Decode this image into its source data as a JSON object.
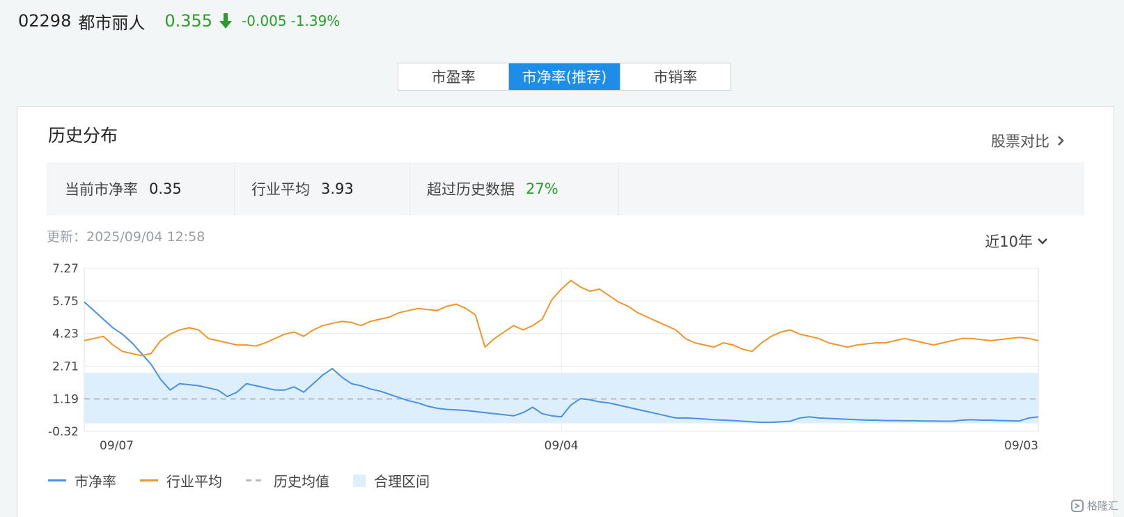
{
  "header": {
    "code": "02298",
    "name": "都市丽人",
    "price": "0.355",
    "change": "-0.005",
    "change_pct": "-1.39%",
    "direction": "down"
  },
  "tabs": [
    {
      "label": "市盈率",
      "active": false
    },
    {
      "label": "市净率(推荐)",
      "active": true
    },
    {
      "label": "市销率",
      "active": false
    }
  ],
  "card": {
    "title": "历史分布",
    "compare_link": "股票对比",
    "stats": [
      {
        "label": "当前市净率",
        "value": "0.35"
      },
      {
        "label": "行业平均",
        "value": "3.93"
      },
      {
        "label": "超过历史数据",
        "value": "27%"
      }
    ],
    "update_label": "更新：",
    "update_time": "2025/09/04 12:58",
    "range_label": "近10年"
  },
  "chart_data": {
    "type": "line",
    "y_ticks": [
      "7.27",
      "5.75",
      "4.23",
      "2.71",
      "1.19",
      "-0.32"
    ],
    "ylim": [
      -0.32,
      7.27
    ],
    "x_ticks": [
      "09/07",
      "09/04",
      "09/03"
    ],
    "historical_mean": 1.19,
    "reasonable_range": [
      0.05,
      2.4
    ],
    "series": [
      {
        "name": "市净率",
        "color": "#4a90e2",
        "x": [
          0,
          1,
          2,
          3,
          4,
          5,
          6,
          7,
          8,
          9,
          10,
          11,
          12,
          13,
          14,
          15,
          16,
          17,
          18,
          19,
          20,
          21,
          22,
          23,
          24,
          25,
          26,
          27,
          28,
          29,
          30,
          31,
          32,
          33,
          34,
          35,
          36,
          37,
          38,
          39,
          40,
          41,
          42,
          43,
          44,
          45,
          46,
          47,
          48,
          49,
          50,
          51,
          52,
          53,
          54,
          55,
          56,
          57,
          58,
          59,
          60,
          61,
          62,
          63,
          64,
          65,
          66,
          67,
          68,
          69,
          70,
          71,
          72,
          73,
          74,
          75,
          76,
          77,
          78,
          79,
          80,
          81,
          82,
          83,
          84,
          85,
          86,
          87,
          88,
          89,
          90,
          91,
          92,
          93,
          94,
          95,
          96,
          97,
          98,
          99,
          100
        ],
        "values": [
          5.7,
          5.3,
          4.9,
          4.5,
          4.2,
          3.8,
          3.3,
          2.8,
          2.1,
          1.6,
          1.9,
          1.85,
          1.8,
          1.7,
          1.6,
          1.3,
          1.5,
          1.9,
          1.8,
          1.7,
          1.6,
          1.6,
          1.75,
          1.5,
          1.9,
          2.3,
          2.6,
          2.2,
          1.9,
          1.8,
          1.65,
          1.55,
          1.4,
          1.25,
          1.1,
          1.0,
          0.85,
          0.75,
          0.7,
          0.68,
          0.65,
          0.6,
          0.55,
          0.5,
          0.45,
          0.4,
          0.55,
          0.8,
          0.5,
          0.4,
          0.35,
          0.9,
          1.2,
          1.15,
          1.05,
          1.0,
          0.9,
          0.8,
          0.7,
          0.6,
          0.5,
          0.4,
          0.3,
          0.3,
          0.28,
          0.25,
          0.22,
          0.2,
          0.18,
          0.15,
          0.12,
          0.1,
          0.1,
          0.12,
          0.15,
          0.3,
          0.35,
          0.3,
          0.28,
          0.26,
          0.24,
          0.22,
          0.2,
          0.2,
          0.18,
          0.18,
          0.17,
          0.17,
          0.16,
          0.16,
          0.15,
          0.15,
          0.2,
          0.22,
          0.2,
          0.2,
          0.18,
          0.17,
          0.16,
          0.3,
          0.35
        ]
      },
      {
        "name": "行业平均",
        "color": "#f0952a",
        "x": [
          0,
          1,
          2,
          3,
          4,
          5,
          6,
          7,
          8,
          9,
          10,
          11,
          12,
          13,
          14,
          15,
          16,
          17,
          18,
          19,
          20,
          21,
          22,
          23,
          24,
          25,
          26,
          27,
          28,
          29,
          30,
          31,
          32,
          33,
          34,
          35,
          36,
          37,
          38,
          39,
          40,
          41,
          42,
          43,
          44,
          45,
          46,
          47,
          48,
          49,
          50,
          51,
          52,
          53,
          54,
          55,
          56,
          57,
          58,
          59,
          60,
          61,
          62,
          63,
          64,
          65,
          66,
          67,
          68,
          69,
          70,
          71,
          72,
          73,
          74,
          75,
          76,
          77,
          78,
          79,
          80,
          81,
          82,
          83,
          84,
          85,
          86,
          87,
          88,
          89,
          90,
          91,
          92,
          93,
          94,
          95,
          96,
          97,
          98,
          99,
          100
        ],
        "values": [
          3.9,
          4.0,
          4.1,
          3.7,
          3.4,
          3.3,
          3.2,
          3.3,
          3.9,
          4.2,
          4.4,
          4.5,
          4.4,
          4.0,
          3.9,
          3.8,
          3.7,
          3.7,
          3.65,
          3.8,
          4.0,
          4.2,
          4.3,
          4.1,
          4.4,
          4.6,
          4.7,
          4.8,
          4.75,
          4.6,
          4.8,
          4.9,
          5.0,
          5.2,
          5.3,
          5.4,
          5.35,
          5.3,
          5.5,
          5.6,
          5.4,
          5.1,
          3.6,
          4.0,
          4.3,
          4.6,
          4.4,
          4.6,
          4.9,
          5.8,
          6.3,
          6.7,
          6.4,
          6.2,
          6.3,
          6.0,
          5.7,
          5.5,
          5.2,
          5.0,
          4.8,
          4.6,
          4.4,
          4.0,
          3.8,
          3.7,
          3.6,
          3.8,
          3.7,
          3.5,
          3.4,
          3.8,
          4.1,
          4.3,
          4.4,
          4.2,
          4.1,
          4.0,
          3.8,
          3.7,
          3.6,
          3.7,
          3.75,
          3.8,
          3.8,
          3.9,
          4.0,
          3.9,
          3.8,
          3.7,
          3.8,
          3.9,
          4.0,
          4.0,
          3.95,
          3.9,
          3.95,
          4.0,
          4.05,
          4.0,
          3.9
        ]
      }
    ],
    "legend": [
      {
        "label": "市净率",
        "kind": "line",
        "color": "#4a90e2"
      },
      {
        "label": "行业平均",
        "kind": "line",
        "color": "#f0952a"
      },
      {
        "label": "历史均值",
        "kind": "dash",
        "color": "#b5bcc6"
      },
      {
        "label": "合理区间",
        "kind": "area",
        "color": "#ddeefc"
      }
    ]
  },
  "watermark": "格隆汇"
}
